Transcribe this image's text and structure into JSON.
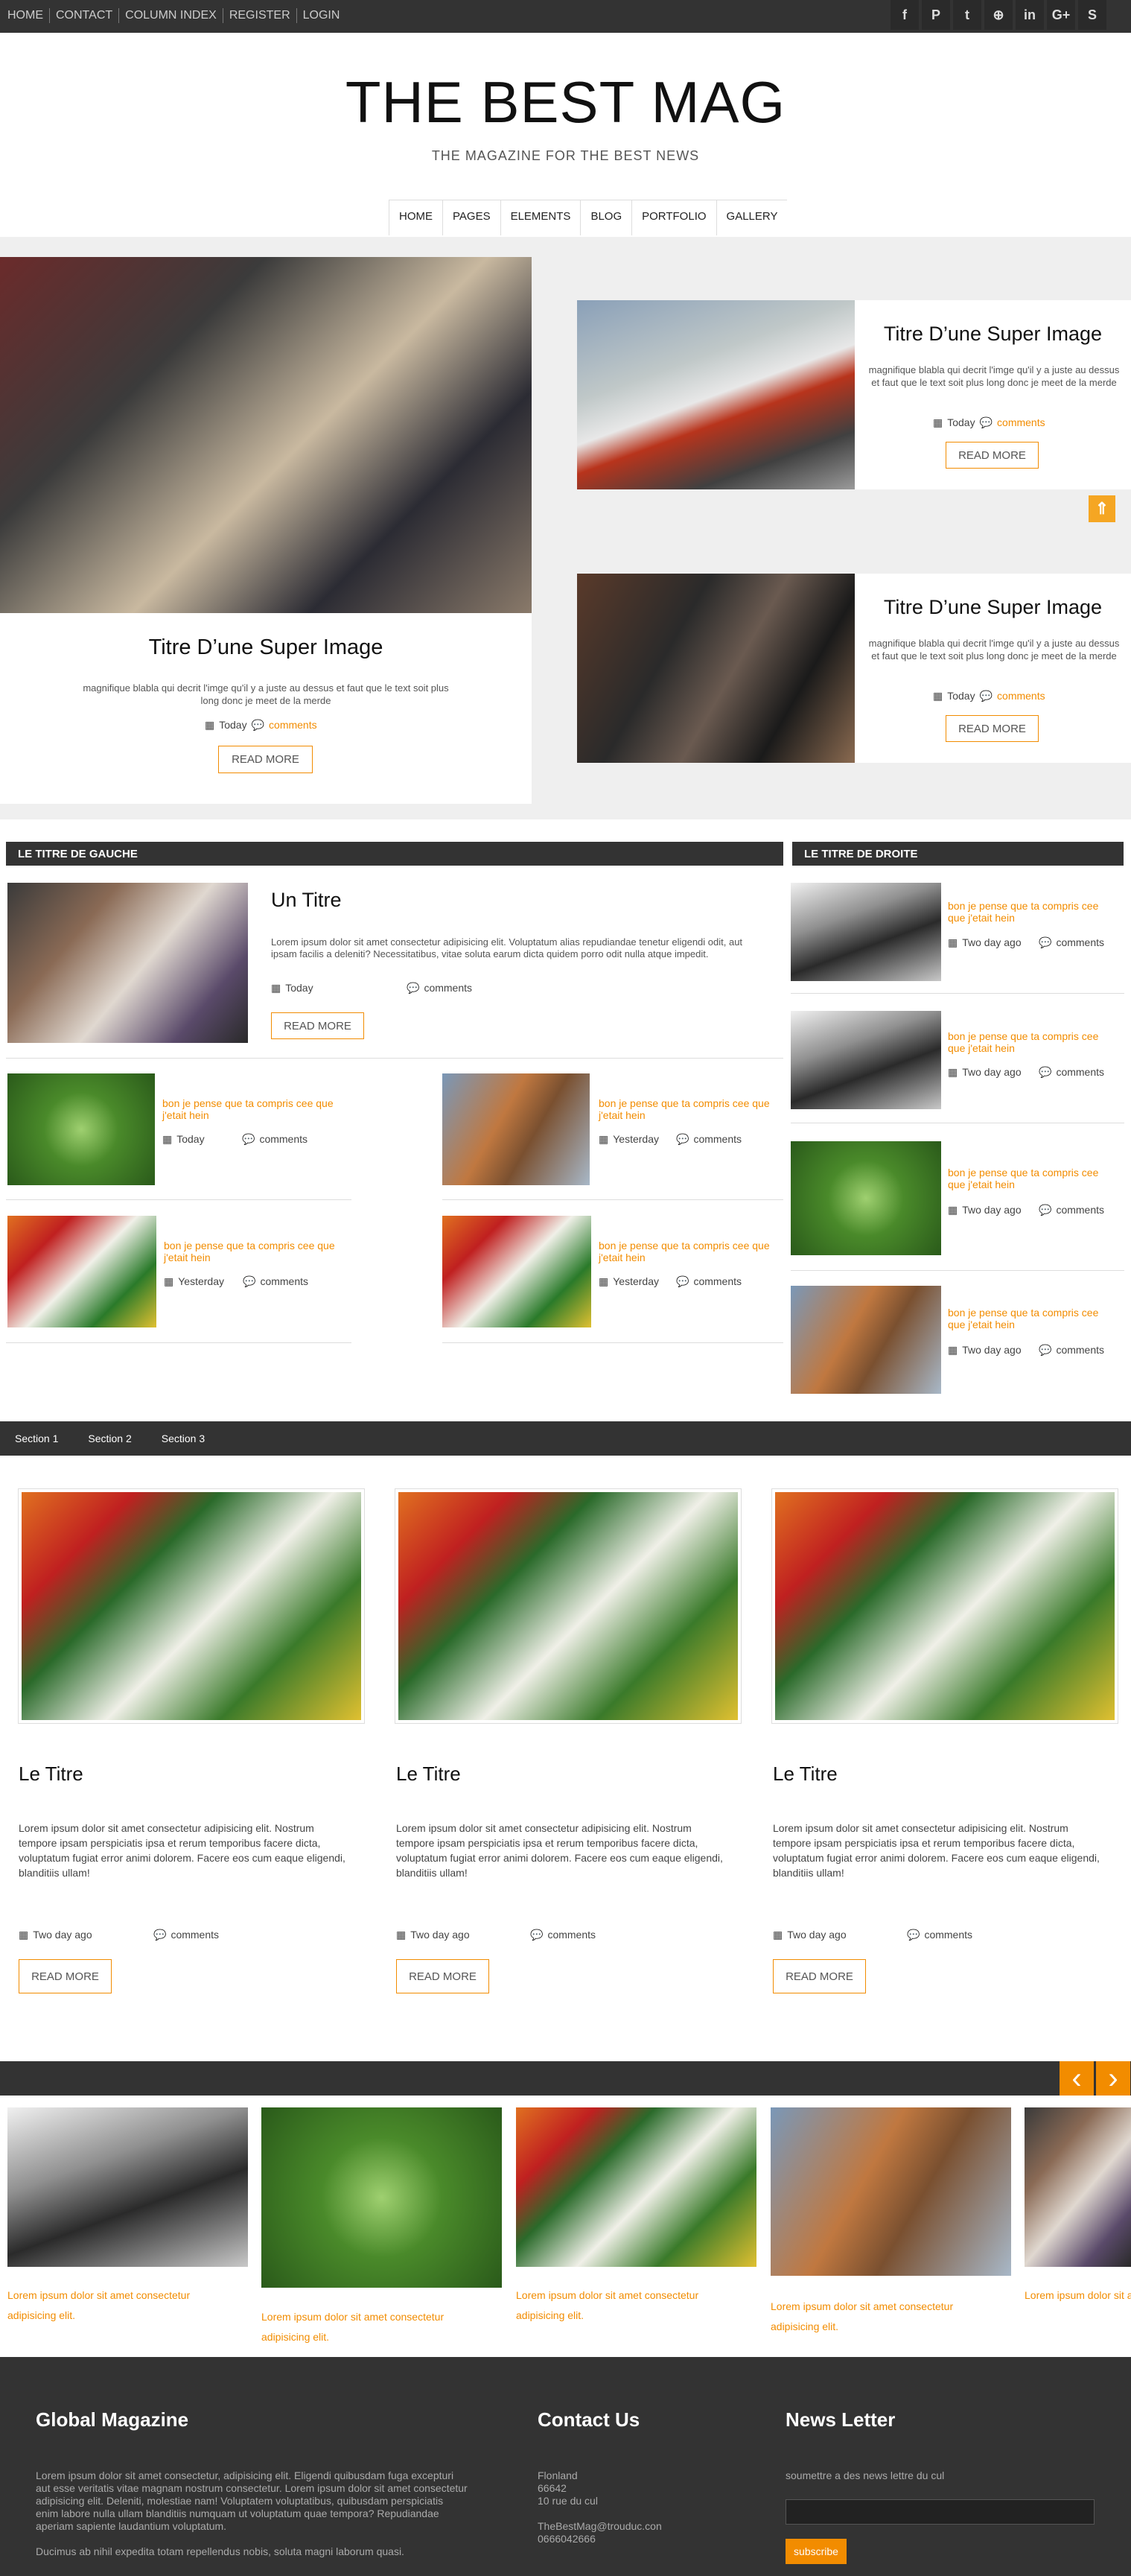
{
  "topbar": {
    "links": [
      "HOME",
      "CONTACT",
      "COLUMN INDEX",
      "REGISTER",
      "LOGIN"
    ],
    "social_icons": [
      "facebook-icon",
      "pinterest-icon",
      "twitter-icon",
      "dribbble-icon",
      "linkedin-icon",
      "googleplus-icon",
      "skype-icon"
    ],
    "social_glyphs": [
      "f",
      "P",
      "t",
      "⊕",
      "in",
      "G+",
      "S"
    ]
  },
  "header": {
    "title": "THE BEST MAG",
    "tagline": "THE MAGAZINE FOR THE BEST NEWS"
  },
  "nav": [
    "HOME",
    "PAGES",
    "ELEMENTS",
    "BLOG",
    "PORTFOLIO",
    "GALLERY"
  ],
  "featured": {
    "main": {
      "title": "Titre D’une Super Image",
      "text": "magnifique blabla qui decrit l'imge qu'il y a juste au dessus et faut que le text soit plus long donc je meet de la merde",
      "date": "Today",
      "comments": "comments",
      "button": "READ MORE"
    },
    "right1": {
      "title": "Titre D’une Super Image",
      "text": "magnifique blabla qui decrit l'imge qu'il y a juste au dessus et faut que le text soit plus long donc je meet de la merde",
      "date": "Today",
      "comments": "comments",
      "button": "READ MORE"
    },
    "right2": {
      "title": "Titre D’une Super Image",
      "text": "magnifique blabla qui decrit l'imge qu'il y a juste au dessus et faut que le text soit plus long donc je meet de la merde",
      "date": "Today",
      "comments": "comments",
      "button": "READ MORE"
    }
  },
  "left_column": {
    "heading": "LE TITRE DE GAUCHE",
    "lead": {
      "title": "Un Titre",
      "text": "Lorem ipsum dolor sit amet consectetur adipisicing elit. Voluptatum alias repudiandae tenetur eligendi odit, aut ipsam facilis a deleniti? Necessitatibus, vitae soluta earum dicta quidem porro odit nulla atque impedit.",
      "date": "Today",
      "comments": "comments",
      "button": "READ MORE"
    },
    "items": [
      {
        "title": "bon je pense que ta compris cee que j'etait hein",
        "date": "Today",
        "comments": "comments"
      },
      {
        "title": "bon je pense que ta compris cee que j'etait hein",
        "date": "Yesterday",
        "comments": "comments"
      },
      {
        "title": "bon je pense que ta compris cee que j'etait hein",
        "date": "Yesterday",
        "comments": "comments"
      },
      {
        "title": "bon je pense que ta compris cee que j'etait hein",
        "date": "Yesterday",
        "comments": "comments"
      }
    ]
  },
  "right_column": {
    "heading": "LE TITRE DE DROITE",
    "items": [
      {
        "title": "bon je pense que ta compris cee que j'etait hein",
        "date": "Two day ago",
        "comments": "comments"
      },
      {
        "title": "bon je pense que ta compris cee que j'etait hein",
        "date": "Two day ago",
        "comments": "comments"
      },
      {
        "title": "bon je pense que ta compris cee que j'etait hein",
        "date": "Two day ago",
        "comments": "comments"
      },
      {
        "title": "bon je pense que ta compris cee que j'etait hein",
        "date": "Two day ago",
        "comments": "comments"
      }
    ]
  },
  "tabs": [
    "Section 1",
    "Section 2",
    "Section 3"
  ],
  "section_cards": [
    {
      "title": "Le Titre",
      "text": "Lorem ipsum dolor sit amet consectetur adipisicing elit. Nostrum tempore ipsam perspiciatis ipsa et rerum temporibus facere dicta, voluptatum fugiat error animi dolorem. Facere eos cum eaque eligendi, blanditiis ullam!",
      "date": "Two day ago",
      "comments": "comments",
      "button": "READ MORE"
    },
    {
      "title": "Le Titre",
      "text": "Lorem ipsum dolor sit amet consectetur adipisicing elit. Nostrum tempore ipsam perspiciatis ipsa et rerum temporibus facere dicta, voluptatum fugiat error animi dolorem. Facere eos cum eaque eligendi, blanditiis ullam!",
      "date": "Two day ago",
      "comments": "comments",
      "button": "READ MORE"
    },
    {
      "title": "Le Titre",
      "text": "Lorem ipsum dolor sit amet consectetur adipisicing elit. Nostrum tempore ipsam perspiciatis ipsa et rerum temporibus facere dicta, voluptatum fugiat error animi dolorem. Facere eos cum eaque eligendi, blanditiis ullam!",
      "date": "Two day ago",
      "comments": "comments",
      "button": "READ MORE"
    }
  ],
  "carousel": {
    "prev_glyph": "‹",
    "next_glyph": "›",
    "captions": [
      "Lorem ipsum dolor sit amet consectetur adipisicing elit.",
      "Lorem ipsum dolor sit amet consectetur adipisicing elit.",
      "Lorem ipsum dolor sit amet consectetur adipisicing elit.",
      "Lorem ipsum dolor sit amet consectetur adipisicing elit.",
      "Lorem ipsum dolor sit amet consectetur adipisicing elit."
    ]
  },
  "footer": {
    "about": {
      "title": "Global Magazine",
      "text": "Lorem ipsum dolor sit amet consectetur, adipisicing elit. Eligendi quibusdam fuga excepturi aut esse veritatis vitae magnam nostrum consectetur. Lorem ipsum dolor sit amet consectetur adipisicing elit. Deleniti, molestiae nam! Voluptatem voluptatibus, quibusdam perspiciatis enim labore nulla ullam blanditiis numquam ut voluptatum quae tempora? Repudiandae aperiam sapiente laudantium voluptatum.",
      "text2": "Ducimus ab nihil expedita totam repellendus nobis, soluta magni laborum quasi."
    },
    "contact": {
      "title": "Contact Us",
      "line1": "Flonland",
      "line2": "66642",
      "line3": "10 rue du cul",
      "email": "TheBestMag@trouduc.con",
      "phone": "0666042666"
    },
    "newsletter": {
      "title": "News Letter",
      "text": "soumettre a des news lettre du cul",
      "input_value": "",
      "button": "subscribe"
    }
  },
  "colors": {
    "accent": "#f28c00",
    "dark": "#333333",
    "light_gray": "#efefef"
  },
  "icons": {
    "calendar": "calendar-icon",
    "comments": "comments-icon",
    "scroll_top": "chevron-up-icon"
  }
}
